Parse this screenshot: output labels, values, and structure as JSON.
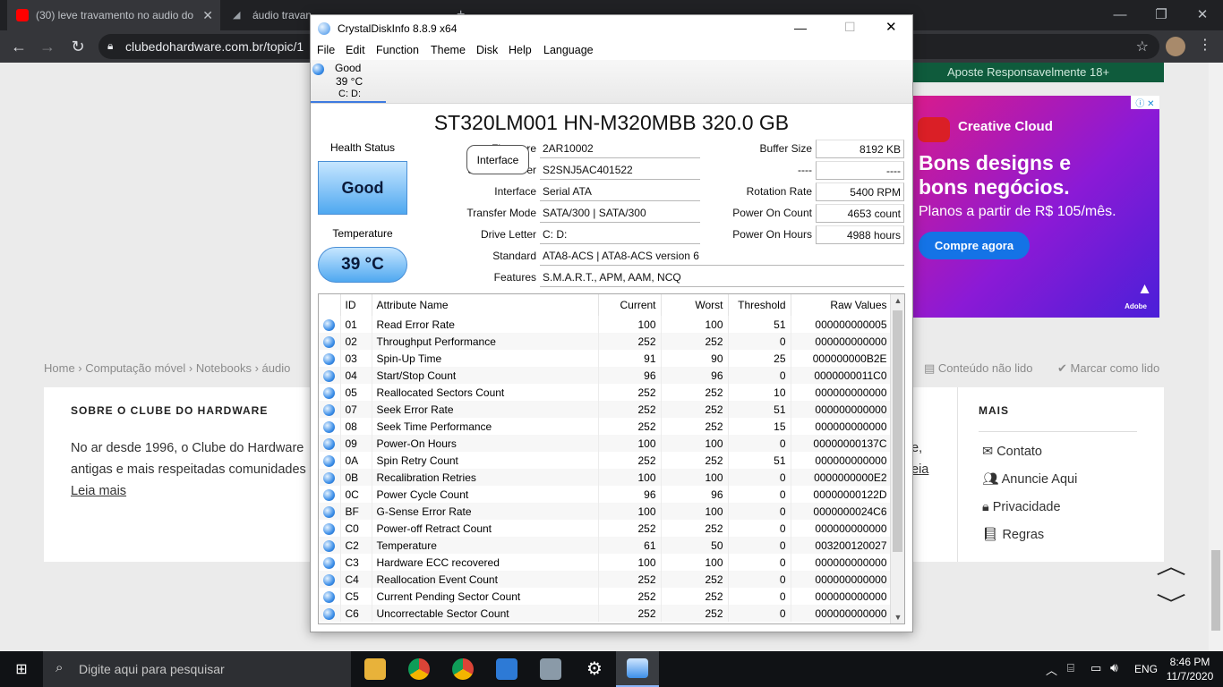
{
  "browser": {
    "tabs": [
      {
        "title": "(30) leve travamento no audio do"
      },
      {
        "title": "áudio travan"
      }
    ],
    "url": "clubedohardware.com.br/topic/1"
  },
  "page": {
    "ad_top": "Aposte Responsavelmente   18+",
    "ad": {
      "brand": "Creative Cloud",
      "headline_1": "Bons designs e",
      "headline_2": "bons negócios.",
      "sub": "Planos a partir de R$ 105/mês.",
      "cta": "Compre agora",
      "adobe": "Adobe"
    },
    "breadcrumb": [
      "Home",
      "Computação móvel",
      "Notebooks",
      "áudio"
    ],
    "bc_unread": "Conteúdo não lido",
    "bc_mark": "Marcar como lido",
    "footer": {
      "about_title": "SOBRE O CLUBE DO HARDWARE",
      "about_line1": "No ar desde 1996, o Clube do Hardware",
      "about_line1_tail": "e,",
      "about_line2": "antigas e mais respeitadas comunidades",
      "about_line2_tail": "eia",
      "read_more": "Leia mais",
      "more_title": "MAIS",
      "links": [
        "Contato",
        "Anuncie Aqui",
        "Privacidade",
        "Regras"
      ]
    }
  },
  "cdi": {
    "title": "CrystalDiskInfo 8.8.9 x64",
    "menu": [
      "File",
      "Edit",
      "Function",
      "Theme",
      "Disk",
      "Help",
      "Language"
    ],
    "drive_tab": {
      "status": "Good",
      "temp": "39 °C",
      "letters": "C: D:"
    },
    "model": "ST320LM001 HN-M320MBB 320.0 GB",
    "health_label": "Health Status",
    "health_value": "Good",
    "temp_label": "Temperature",
    "temp_value": "39 °C",
    "tooltip": "Interface",
    "fields_left": [
      {
        "label": "Firmware",
        "value": "2AR10002"
      },
      {
        "label": "Serial Number",
        "value": "S2SNJ5AC401522"
      },
      {
        "label": "Interface",
        "value": "Serial ATA"
      },
      {
        "label": "Transfer Mode",
        "value": "SATA/300 | SATA/300"
      },
      {
        "label": "Drive Letter",
        "value": "C: D:"
      }
    ],
    "fields_right": [
      {
        "label": "Buffer Size",
        "value": "8192 KB"
      },
      {
        "label": "----",
        "value": "----"
      },
      {
        "label": "Rotation Rate",
        "value": "5400 RPM"
      },
      {
        "label": "Power On Count",
        "value": "4653 count"
      },
      {
        "label": "Power On Hours",
        "value": "4988 hours"
      }
    ],
    "standard_label": "Standard",
    "standard_value": "ATA8-ACS | ATA8-ACS version 6",
    "features_label": "Features",
    "features_value": "S.M.A.R.T., APM, AAM, NCQ",
    "smart_headers": [
      "ID",
      "Attribute Name",
      "Current",
      "Worst",
      "Threshold",
      "Raw Values"
    ],
    "smart_rows": [
      [
        "01",
        "Read Error Rate",
        "100",
        "100",
        "51",
        "000000000005"
      ],
      [
        "02",
        "Throughput Performance",
        "252",
        "252",
        "0",
        "000000000000"
      ],
      [
        "03",
        "Spin-Up Time",
        "91",
        "90",
        "25",
        "000000000B2E"
      ],
      [
        "04",
        "Start/Stop Count",
        "96",
        "96",
        "0",
        "0000000011C0"
      ],
      [
        "05",
        "Reallocated Sectors Count",
        "252",
        "252",
        "10",
        "000000000000"
      ],
      [
        "07",
        "Seek Error Rate",
        "252",
        "252",
        "51",
        "000000000000"
      ],
      [
        "08",
        "Seek Time Performance",
        "252",
        "252",
        "15",
        "000000000000"
      ],
      [
        "09",
        "Power-On Hours",
        "100",
        "100",
        "0",
        "00000000137C"
      ],
      [
        "0A",
        "Spin Retry Count",
        "252",
        "252",
        "51",
        "000000000000"
      ],
      [
        "0B",
        "Recalibration Retries",
        "100",
        "100",
        "0",
        "0000000000E2"
      ],
      [
        "0C",
        "Power Cycle Count",
        "96",
        "96",
        "0",
        "00000000122D"
      ],
      [
        "BF",
        "G-Sense Error Rate",
        "100",
        "100",
        "0",
        "0000000024C6"
      ],
      [
        "C0",
        "Power-off Retract Count",
        "252",
        "252",
        "0",
        "000000000000"
      ],
      [
        "C2",
        "Temperature",
        "61",
        "50",
        "0",
        "003200120027"
      ],
      [
        "C3",
        "Hardware ECC recovered",
        "100",
        "100",
        "0",
        "000000000000"
      ],
      [
        "C4",
        "Reallocation Event Count",
        "252",
        "252",
        "0",
        "000000000000"
      ],
      [
        "C5",
        "Current Pending Sector Count",
        "252",
        "252",
        "0",
        "000000000000"
      ],
      [
        "C6",
        "Uncorrectable Sector Count",
        "252",
        "252",
        "0",
        "000000000000"
      ]
    ]
  },
  "taskbar": {
    "search_placeholder": "Digite aqui para pesquisar",
    "lang": "ENG",
    "time": "8:46 PM",
    "date": "11/7/2020"
  }
}
